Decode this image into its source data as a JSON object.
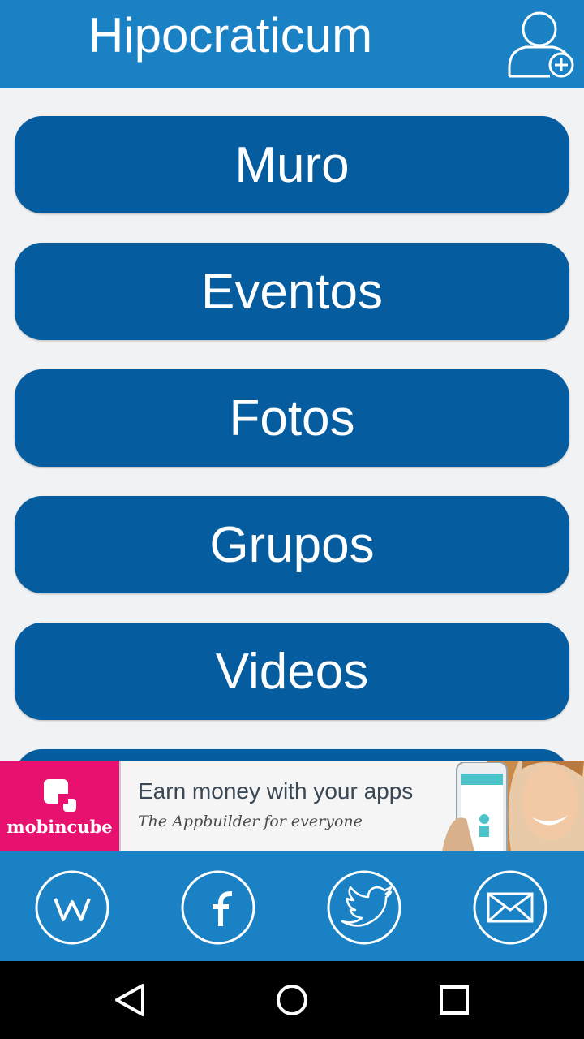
{
  "app": {
    "title": "Hipocraticum",
    "add_user_icon": "add-user-icon"
  },
  "menu": {
    "items": [
      {
        "label": "Muro"
      },
      {
        "label": "Eventos"
      },
      {
        "label": "Fotos"
      },
      {
        "label": "Grupos"
      },
      {
        "label": "Videos"
      }
    ]
  },
  "ad": {
    "brand": "mobincube",
    "headline": "Earn money with your apps",
    "subline": "The Appbuilder for everyone"
  },
  "social": {
    "icons": [
      "wordpress-icon",
      "facebook-icon",
      "twitter-icon",
      "mail-icon"
    ]
  },
  "navbar": {
    "icons": [
      "back-icon",
      "home-icon",
      "recents-icon"
    ]
  },
  "colors": {
    "header": "#1a82c4",
    "button": "#055c9f",
    "background": "#f0f2f4",
    "ad_brand": "#e9116f"
  }
}
